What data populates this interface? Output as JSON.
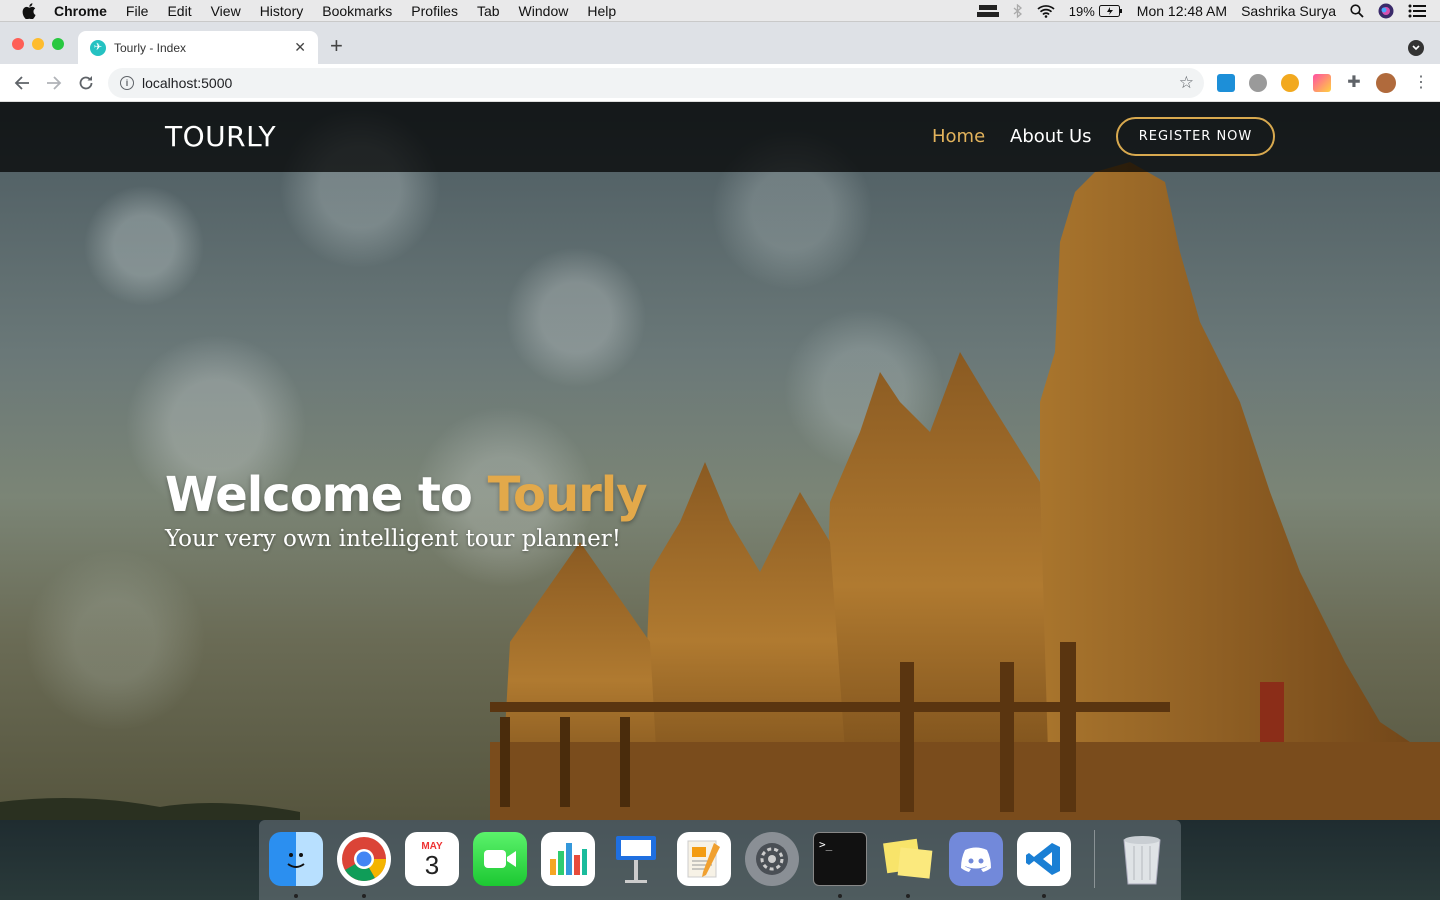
{
  "menubar": {
    "items": [
      "Chrome",
      "File",
      "Edit",
      "View",
      "History",
      "Bookmarks",
      "Profiles",
      "Tab",
      "Window",
      "Help"
    ],
    "battery": "19%",
    "clock": "Mon 12:48 AM",
    "user": "Sashrika Surya"
  },
  "browser": {
    "tab_title": "Tourly - Index",
    "url": "localhost:5000"
  },
  "site": {
    "brand": "TOURLY",
    "nav": {
      "home": "Home",
      "about": "About Us"
    },
    "register_label": "REGISTER NOW",
    "hero_title_prefix": "Welcome to ",
    "hero_title_accent": "Tourly",
    "hero_subtitle": "Your very own intelligent tour planner!"
  },
  "colors": {
    "accent": "#e3b35c",
    "nav_bg": "rgba(0,0,0,0.72)"
  },
  "dock": {
    "apps": [
      "finder-icon",
      "chrome-icon",
      "calendar-icon",
      "facetime-icon",
      "numbers-icon",
      "keynote-icon",
      "pages-icon",
      "system-preferences-icon",
      "terminal-icon",
      "stickies-icon",
      "discord-icon",
      "vscode-icon",
      "trash-icon"
    ],
    "calendar_month": "MAY",
    "calendar_day": "3"
  }
}
